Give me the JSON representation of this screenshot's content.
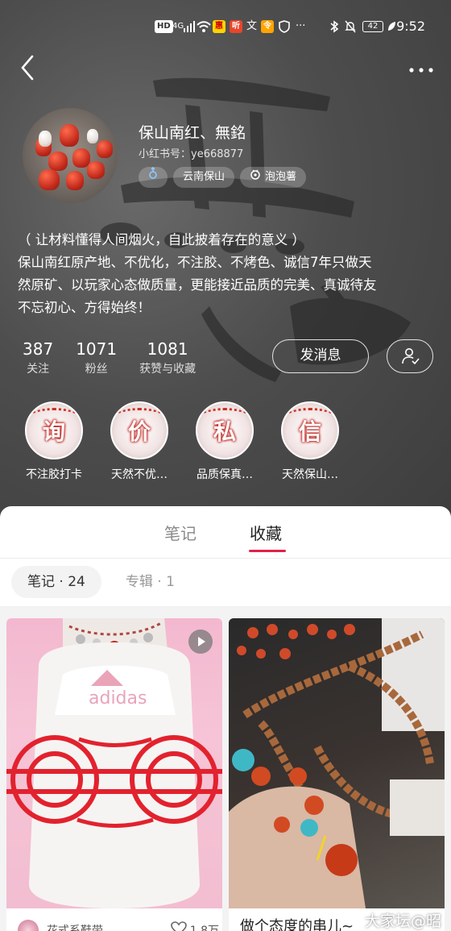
{
  "status_bar": {
    "left_badges": [
      "HD",
      "4G"
    ],
    "app_badges": [
      "惠",
      "听",
      "文",
      "令"
    ],
    "more": "···",
    "battery": "42",
    "time": "9:52"
  },
  "profile": {
    "nickname": "保山南红、無銘",
    "red_id": "小红书号：ye668877",
    "tags": [
      {
        "label": "",
        "icon": "male-icon"
      },
      {
        "label": "云南保山",
        "icon": ""
      },
      {
        "label": "泡泡薯",
        "icon": "tag-icon"
      }
    ],
    "bio_lines": [
      "（ 让材料懂得人间烟火，自此披着存在的意义 ）",
      "保山南红原产地、不优化，不注胶、不烤色、诚信7年只做天",
      "然原矿、以玩家心态做质量，更能接近品质的完美、真诚待友",
      "不忘初心、方得始终！"
    ],
    "stats": [
      {
        "value": "387",
        "label": "关注"
      },
      {
        "value": "1071",
        "label": "粉丝"
      },
      {
        "value": "1081",
        "label": "获赞与收藏"
      }
    ],
    "message_button": "发消息",
    "highlights": [
      {
        "char": "询",
        "label": "不注胶打卡"
      },
      {
        "char": "价",
        "label": "天然不优…"
      },
      {
        "char": "私",
        "label": "品质保真…"
      },
      {
        "char": "信",
        "label": "天然保山…"
      }
    ]
  },
  "tabs": [
    {
      "label": "笔记",
      "active": false
    },
    {
      "label": "收藏",
      "active": true
    }
  ],
  "chips": [
    {
      "label": "笔记",
      "count": "24",
      "active": true
    },
    {
      "label": "专辑",
      "count": "1",
      "active": false
    }
  ],
  "cards": [
    {
      "title": "",
      "author": "花式系鞋带",
      "likes": "1.8万"
    },
    {
      "title": "做个态度的串儿~",
      "author": "",
      "likes": ""
    }
  ],
  "watermark": "大家坛@昭",
  "colors": {
    "accent": "#e0224a",
    "header_bg": "#4d4d4d",
    "coral": "#c93020"
  }
}
